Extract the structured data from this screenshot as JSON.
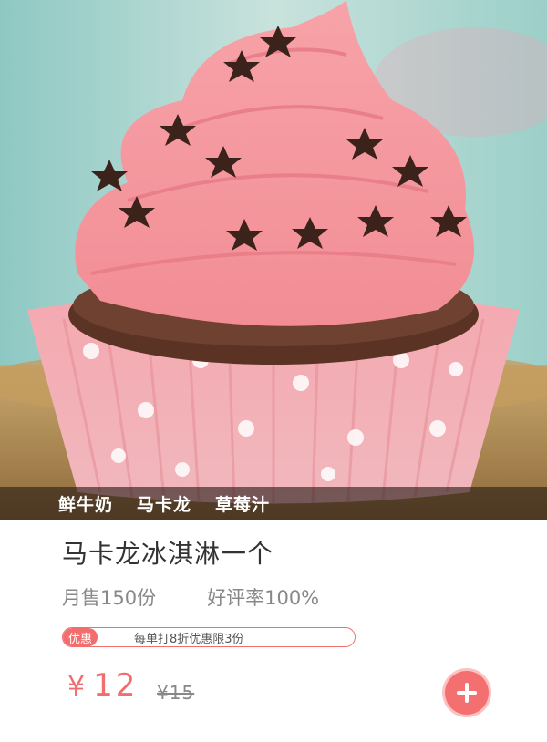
{
  "product": {
    "tags": [
      "鲜牛奶",
      "马卡龙",
      "草莓汁"
    ],
    "title": "马卡龙冰淇淋一个",
    "monthly_sales": "月售150份",
    "rating": "好评率100%",
    "promo_badge": "优惠",
    "promo_text": "每单打8折优惠限3份",
    "currency": "¥",
    "price": "12",
    "original_price": "¥15"
  },
  "icons": {
    "add": "plus-icon",
    "image": "cupcake-image"
  },
  "colors": {
    "accent": "#f26d6d",
    "title": "#333333",
    "muted": "#888888"
  }
}
